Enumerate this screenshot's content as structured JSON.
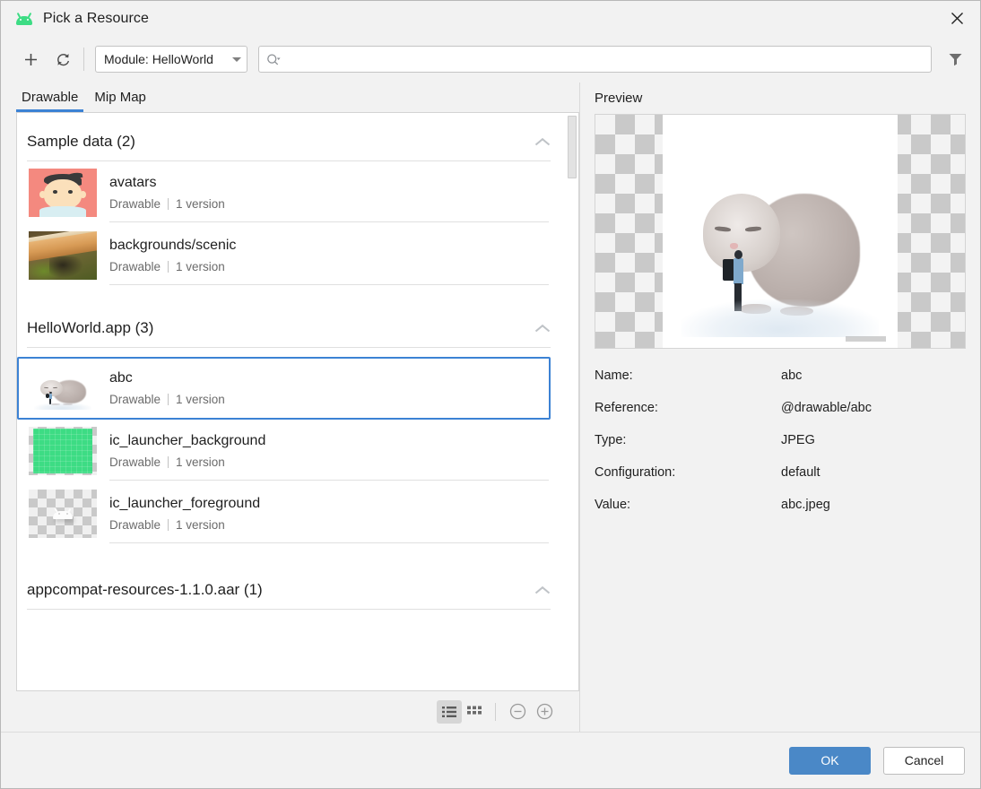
{
  "window": {
    "title": "Pick a Resource",
    "logo_icon": "android-logo-icon",
    "close_icon": "close-icon"
  },
  "toolbar": {
    "add_icon": "plus-icon",
    "refresh_icon": "refresh-icon",
    "module_label": "Module: HelloWorld",
    "module_caret_icon": "chevron-down-icon",
    "search_placeholder": "",
    "search_value": "",
    "search_icon": "search-icon",
    "filter_icon": "filter-icon"
  },
  "tabs": [
    {
      "label": "Drawable",
      "active": true
    },
    {
      "label": "Mip Map",
      "active": false
    }
  ],
  "sections": [
    {
      "title": "Sample data (2)",
      "collapse_icon": "chevron-up-icon",
      "items": [
        {
          "name": "avatars",
          "type": "Drawable",
          "versions": "1 version",
          "thumb": "avatar-thumb",
          "selected": false
        },
        {
          "name": "backgrounds/scenic",
          "type": "Drawable",
          "versions": "1 version",
          "thumb": "scenic-thumb",
          "selected": false
        }
      ]
    },
    {
      "title": "HelloWorld.app (3)",
      "collapse_icon": "chevron-up-icon",
      "items": [
        {
          "name": "abc",
          "type": "Drawable",
          "versions": "1 version",
          "thumb": "cat-thumb",
          "selected": true
        },
        {
          "name": "ic_launcher_background",
          "type": "Drawable",
          "versions": "1 version",
          "thumb": "green-thumb",
          "selected": false
        },
        {
          "name": "ic_launcher_foreground",
          "type": "Drawable",
          "versions": "1 version",
          "thumb": "droid-thumb",
          "selected": false
        }
      ]
    },
    {
      "title": "appcompat-resources-1.1.0.aar (1)",
      "collapse_icon": "chevron-up-icon",
      "items": []
    }
  ],
  "list_footer": {
    "list_view_icon": "list-view-icon",
    "grid_view_icon": "grid-view-icon",
    "zoom_out_icon": "zoom-out-icon",
    "zoom_in_icon": "zoom-in-icon",
    "active_view": "list"
  },
  "preview": {
    "label": "Preview",
    "image_alt": "cat-illustration",
    "properties": [
      {
        "key": "Name:",
        "value": "abc"
      },
      {
        "key": "Reference:",
        "value": "@drawable/abc"
      },
      {
        "key": "Type:",
        "value": "JPEG"
      },
      {
        "key": "Configuration:",
        "value": "default"
      },
      {
        "key": "Value:",
        "value": "abc.jpeg"
      }
    ]
  },
  "footer": {
    "ok_label": "OK",
    "cancel_label": "Cancel"
  },
  "colors": {
    "accent": "#3c82d4",
    "primary_button": "#4a88c7",
    "android_green": "#3ddc84"
  }
}
